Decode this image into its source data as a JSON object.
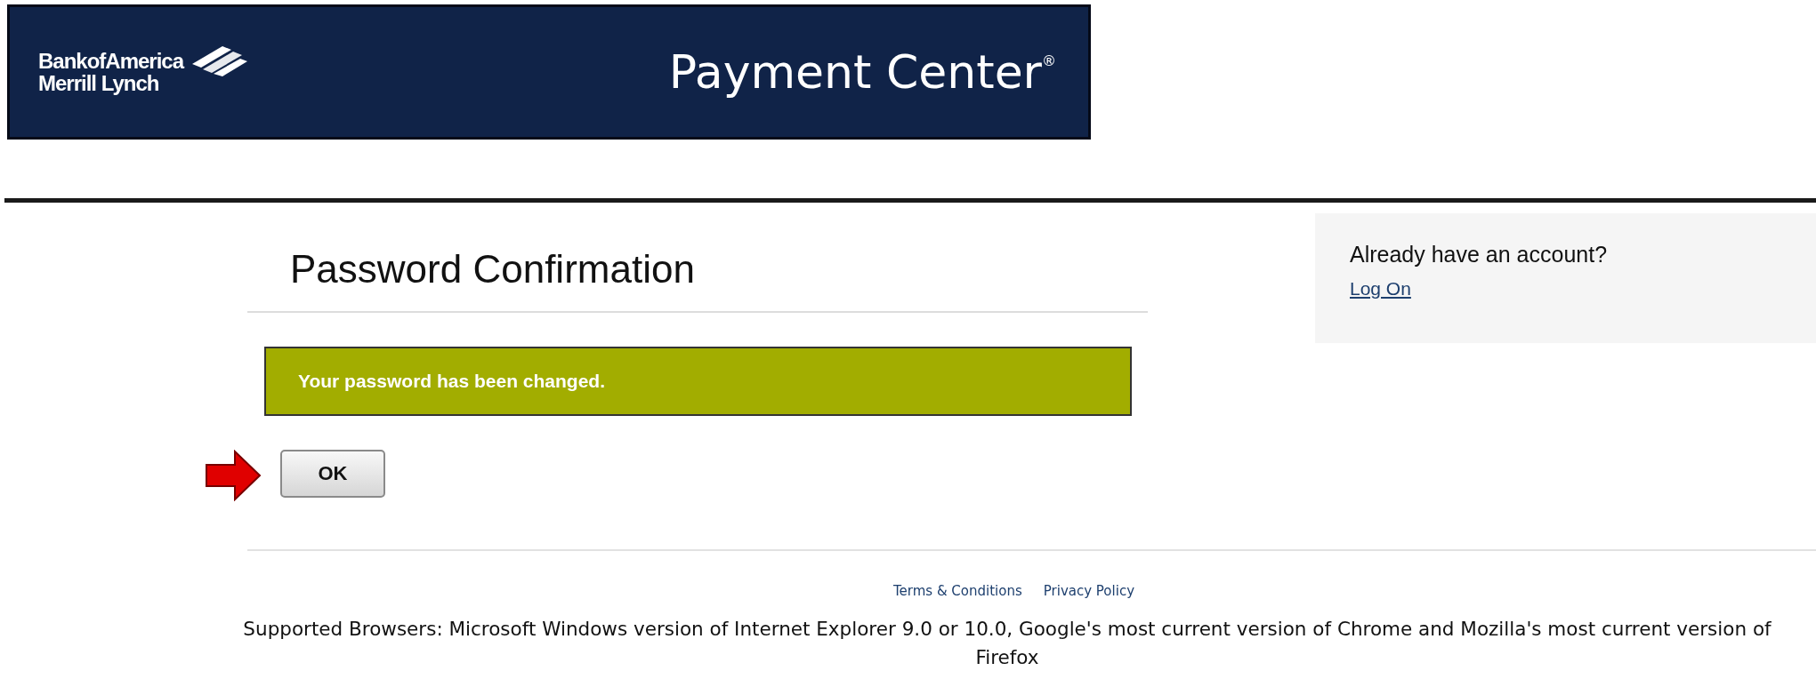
{
  "header": {
    "logo_lines": [
      "BankofAmerica",
      "Merrill Lynch"
    ],
    "title": "Payment Center$^{®}$"
  },
  "main": {
    "heading": "Password Confirmation",
    "message": "Your password has been changed.",
    "button": "OK",
    "pointer_arrow": true
  },
  "account_panel": {
    "prompt": "Already have an account?",
    "link": "Log On"
  },
  "footer": {
    "links": [
      "Terms & Conditions",
      "Privacy Policy"
    ],
    "note": "Supported Browsers: Microsoft Windows version of Internet Explorer 9.0 or 10.0, Google's most current version of Chrome and Mozilla's most current version of Firefox"
  }
}
